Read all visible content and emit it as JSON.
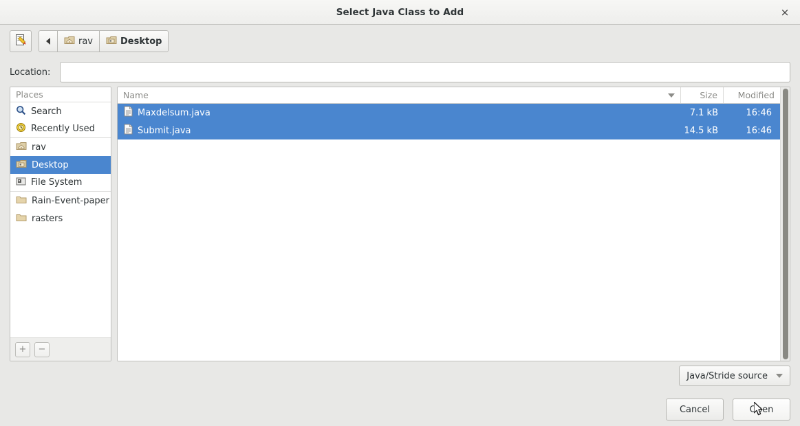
{
  "window": {
    "title": "Select Java Class to Add",
    "close_label": "×",
    "close_icon": "close-icon"
  },
  "toolbar": {
    "type_filename_icon": "edit-document-icon",
    "back_icon": "back-arrow-icon",
    "path_buttons": [
      {
        "label": "rav",
        "icon": "home-folder-icon",
        "current": false
      },
      {
        "label": "Desktop",
        "icon": "desktop-folder-icon",
        "current": true
      }
    ]
  },
  "location": {
    "label": "Location:",
    "value": "",
    "placeholder": ""
  },
  "sidebar": {
    "header": "Places",
    "items": [
      {
        "label": "Search",
        "icon": "search-icon",
        "selected": false
      },
      {
        "label": "Recently Used",
        "icon": "recent-clock-icon",
        "selected": false
      },
      {
        "label": "rav",
        "icon": "home-folder-icon",
        "selected": false
      },
      {
        "label": "Desktop",
        "icon": "desktop-folder-icon",
        "selected": true
      },
      {
        "label": "File System",
        "icon": "drive-icon",
        "selected": false
      },
      {
        "label": "Rain-Event-paper",
        "icon": "folder-icon",
        "selected": false
      },
      {
        "label": "rasters",
        "icon": "folder-icon",
        "selected": false
      }
    ],
    "add_label": "+",
    "remove_label": "−"
  },
  "file_list": {
    "columns": [
      "Name",
      "Size",
      "Modified"
    ],
    "sort_column": "Name",
    "sort_direction": "descending",
    "rows": [
      {
        "name": "Maxdelsum.java",
        "size": "7.1 kB",
        "modified": "16:46",
        "icon": "text-file-icon",
        "selected": true
      },
      {
        "name": "Submit.java",
        "size": "14.5 kB",
        "modified": "16:46",
        "icon": "text-file-icon",
        "selected": true
      }
    ]
  },
  "footer": {
    "filter": {
      "selected": "Java/Stride source",
      "chevron_icon": "chevron-down-icon"
    },
    "cancel_label": "Cancel",
    "open_label": "Open"
  },
  "colors": {
    "selection": "#4a86cf",
    "window_bg": "#e8e8e6",
    "list_bg": "#ffffff",
    "text": "#2e3436",
    "muted_text": "#8c8c88",
    "border": "#b7b7b3",
    "folder": "#d9be8f"
  }
}
